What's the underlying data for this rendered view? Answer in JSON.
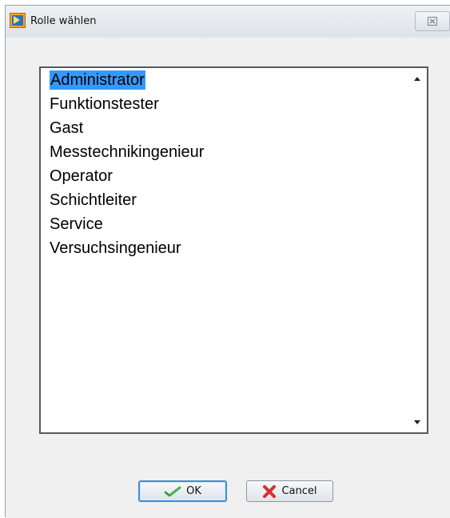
{
  "window": {
    "title": "Rolle wählen",
    "close_glyph": "☒"
  },
  "list": {
    "items": [
      "Administrator",
      "Funktionstester",
      "Gast",
      "Messtechnikingenieur",
      "Operator",
      "Schichtleiter",
      "Service",
      "Versuchsingenieur"
    ],
    "selected": "Administrator"
  },
  "buttons": {
    "ok_label": "OK",
    "cancel_label": "Cancel"
  },
  "icons": {
    "app": "labview-app-icon",
    "ok": "check-icon",
    "cancel": "x-icon",
    "close": "close-icon"
  },
  "colors": {
    "selection": "#3399ff",
    "ok_check": "#4caf50",
    "cancel_x": "#d32f2f"
  }
}
